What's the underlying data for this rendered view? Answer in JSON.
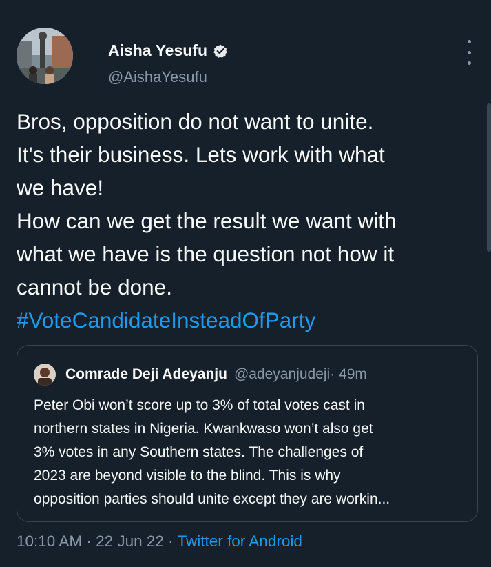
{
  "author": {
    "display_name": "Aisha Yesufu",
    "handle": "@AishaYesufu"
  },
  "tweet": {
    "lines": [
      "Bros, opposition do not want to unite.",
      "It's their business. Lets work with what",
      "we have!",
      "How can we get the result we want with",
      "what we have is the question not how it",
      "cannot be done."
    ],
    "hashtag": "#VoteCandidateInsteadOfParty"
  },
  "quoted": {
    "display_name": "Comrade Deji Adeyanju",
    "handle": "@adeyanjudeji",
    "time": " · 49m",
    "lines": [
      "Peter Obi won’t score up to 3% of total votes cast in",
      "northern states in Nigeria. Kwankwaso won’t also get",
      "3% votes in any Southern states. The challenges of",
      "2023 are beyond visible to the blind. This is why",
      "opposition parties should unite except they are workin..."
    ]
  },
  "meta": {
    "time": "10:10 AM",
    "sep1": " · ",
    "date": "22 Jun 22",
    "sep2": " · ",
    "source": "Twitter for Android"
  },
  "icons": {
    "verified": "verified-badge-icon",
    "more": "more-options-icon"
  },
  "colors": {
    "background": "#15202b",
    "link": "#1d9bf0",
    "secondary": "#8b98a5"
  }
}
